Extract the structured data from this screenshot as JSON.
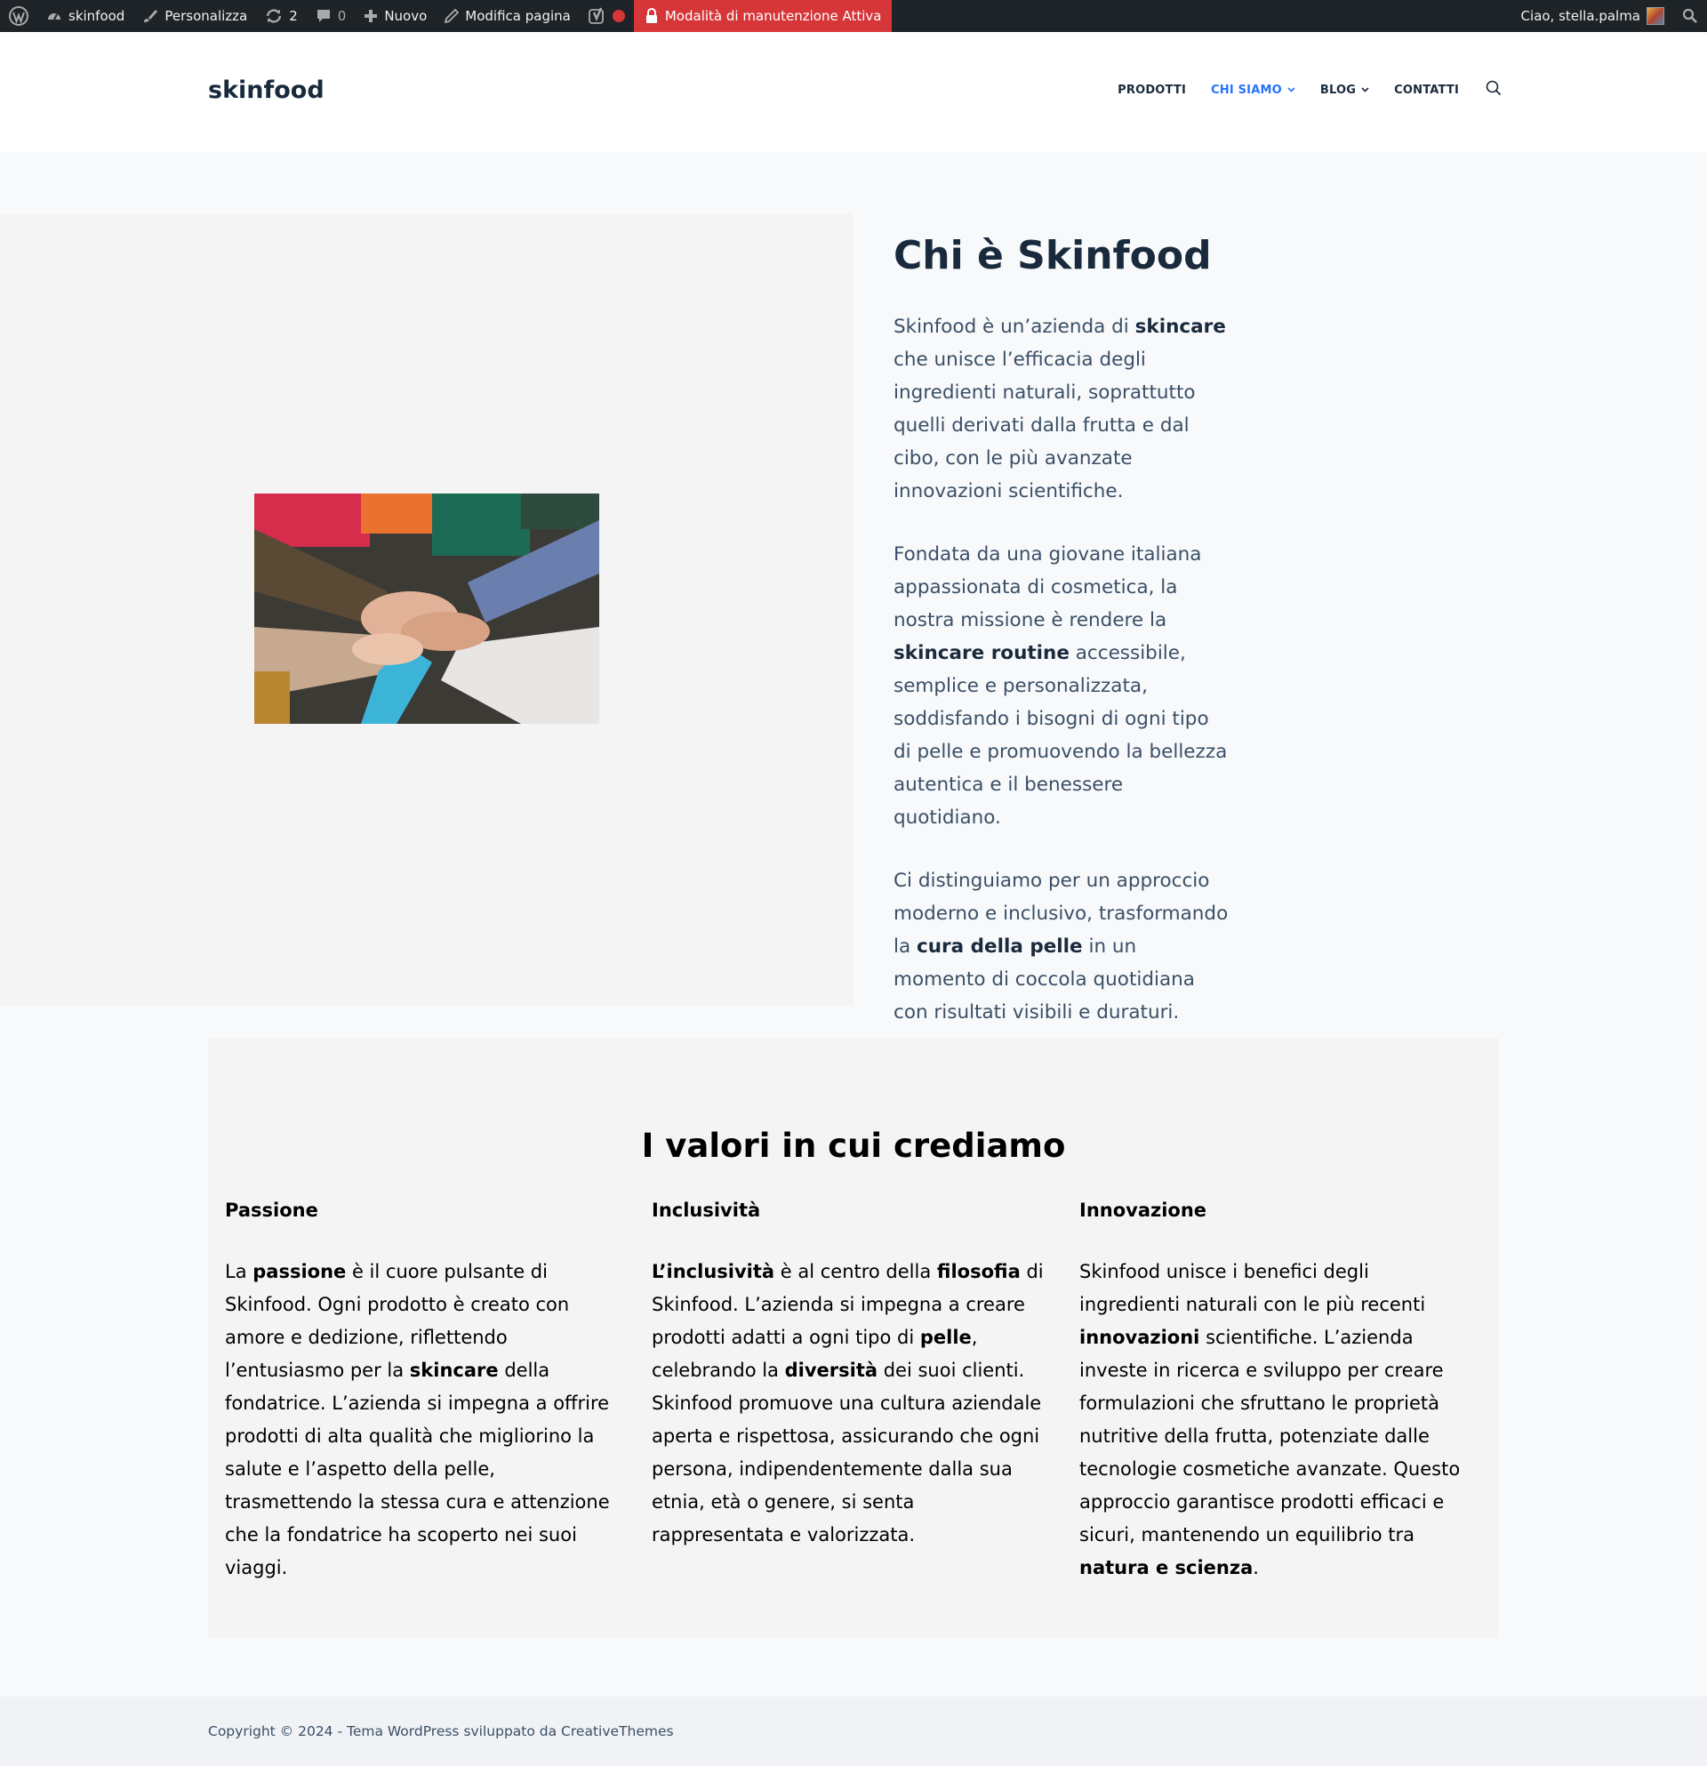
{
  "adminbar": {
    "site_name": "skinfood",
    "customize_label": "Personalizza",
    "updates_count": "2",
    "comments_count": "0",
    "new_label": "Nuovo",
    "edit_label": "Modifica pagina",
    "maintenance_label": "Modalità di manutenzione Attiva",
    "greeting": "Ciao, stella.palma"
  },
  "header": {
    "logo": "skinfood",
    "nav": {
      "products": "PRODOTTI",
      "about": "CHI SIAMO",
      "blog": "BLOG",
      "contacts": "CONTATTI"
    }
  },
  "hero": {
    "title": "Chi è Skinfood",
    "p1": [
      "Skinfood è un’azienda di ",
      "skincare",
      " che unisce l’efficacia degli ingredienti naturali, soprattutto quelli derivati dalla frutta e dal cibo, con le più avanzate innovazioni scientifiche."
    ],
    "p2": [
      "Fondata da una giovane italiana appassionata di cosmetica, la nostra missione è rendere la ",
      "skincare routine",
      " accessibile, semplice e personalizzata, soddisfando i bisogni di ogni tipo di pelle e promuovendo la bellezza autentica e il benessere quotidiano."
    ],
    "p3": [
      "Ci distinguiamo per un approccio moderno e inclusivo, trasformando la ",
      "cura della pelle",
      " in un momento di coccola quotidiana con risultati visibili e duraturi."
    ]
  },
  "values": {
    "title": "I valori in cui crediamo",
    "passion": {
      "heading": "Passione",
      "text": [
        "La ",
        "passione",
        " è il cuore pulsante di Skinfood. Ogni prodotto è creato con amore e dedizione, riflettendo l’entusiasmo per la ",
        "skincare",
        " della fondatrice. L’azienda si impegna a offrire prodotti di alta qualità che migliorino la salute e l’aspetto della pelle, trasmettendo la stessa cura e attenzione che la fondatrice ha scoperto nei suoi viaggi."
      ]
    },
    "inclusivity": {
      "heading": "Inclusività",
      "text": [
        "L’inclusività",
        " è al centro della ",
        "filosofia",
        " di Skinfood. L’azienda si impegna a creare prodotti adatti a ogni tipo di ",
        "pelle",
        ", celebrando la ",
        "diversità",
        " dei suoi clienti. Skinfood promuove una cultura aziendale aperta e rispettosa, assicurando che ogni persona, indipendentemente dalla sua etnia, età o genere, si senta rappresentata e valorizzata."
      ]
    },
    "innovation": {
      "heading": "Innovazione",
      "text": [
        "Skinfood unisce i benefici degli ingredienti naturali con le più recenti ",
        "innovazioni",
        " scientifiche. L’azienda investe in ricerca e sviluppo per creare formulazioni che sfruttano le proprietà nutritive della frutta, potenziate dalle tecnologie cosmetiche avanzate. Questo approccio garantisce prodotti efficaci e sicuri, mantenendo un equilibrio tra ",
        "natura e scienza",
        "."
      ]
    }
  },
  "footer": {
    "copyright": "Copyright © 2024 - Tema WordPress sviluppato da CreativeThemes"
  },
  "colors": {
    "admin_bar": "#1d2327",
    "maintenance": "#d63638",
    "accent": "#2872fa",
    "heading": "#192a3d"
  }
}
